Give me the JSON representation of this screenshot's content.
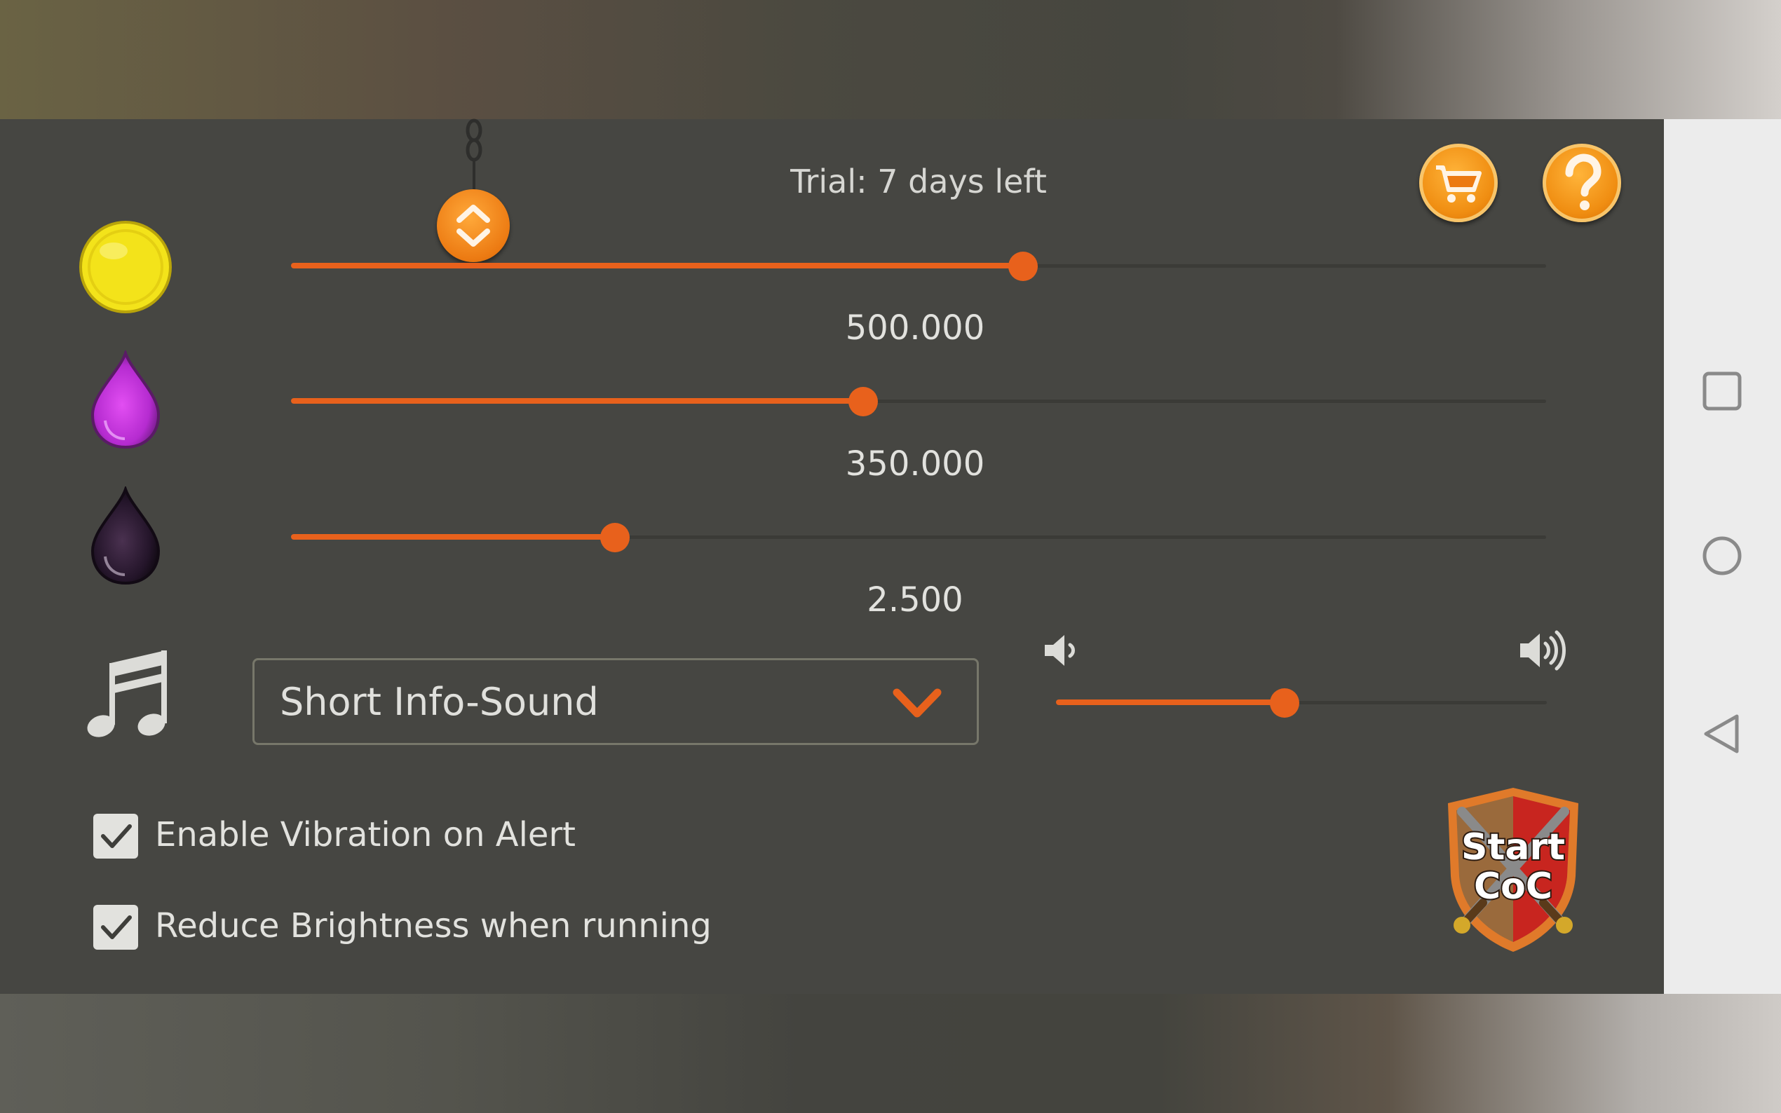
{
  "header": {
    "trial_text": "Trial: 7 days left"
  },
  "toolbar": {
    "shop_icon": "shopping-cart-icon",
    "help_icon": "question-mark-icon"
  },
  "resources": [
    {
      "name": "gold",
      "icon": "gold-coin-icon",
      "value_label": "500.000",
      "slider_fraction": 0.583
    },
    {
      "name": "elixir",
      "icon": "elixir-drop-icon",
      "value_label": "350.000",
      "slider_fraction": 0.456
    },
    {
      "name": "dark_elixir",
      "icon": "dark-elixir-drop-icon",
      "value_label": "2.500",
      "slider_fraction": 0.258
    }
  ],
  "sound": {
    "icon": "music-note-icon",
    "selected_sound": "Short Info-Sound",
    "volume_fraction": 0.465
  },
  "options": {
    "vibration_label": "Enable Vibration on Alert",
    "vibration_checked": true,
    "brightness_label": "Reduce Brightness when running",
    "brightness_checked": true
  },
  "start_button": {
    "line1": "Start",
    "line2": "CoC"
  },
  "colors": {
    "accent": "#e8611c",
    "panel": "#464642",
    "button_orange": "#f08e12",
    "gold": "#f3e31a",
    "elixir": "#c030d8",
    "dark_elixir": "#2a1a2c"
  }
}
